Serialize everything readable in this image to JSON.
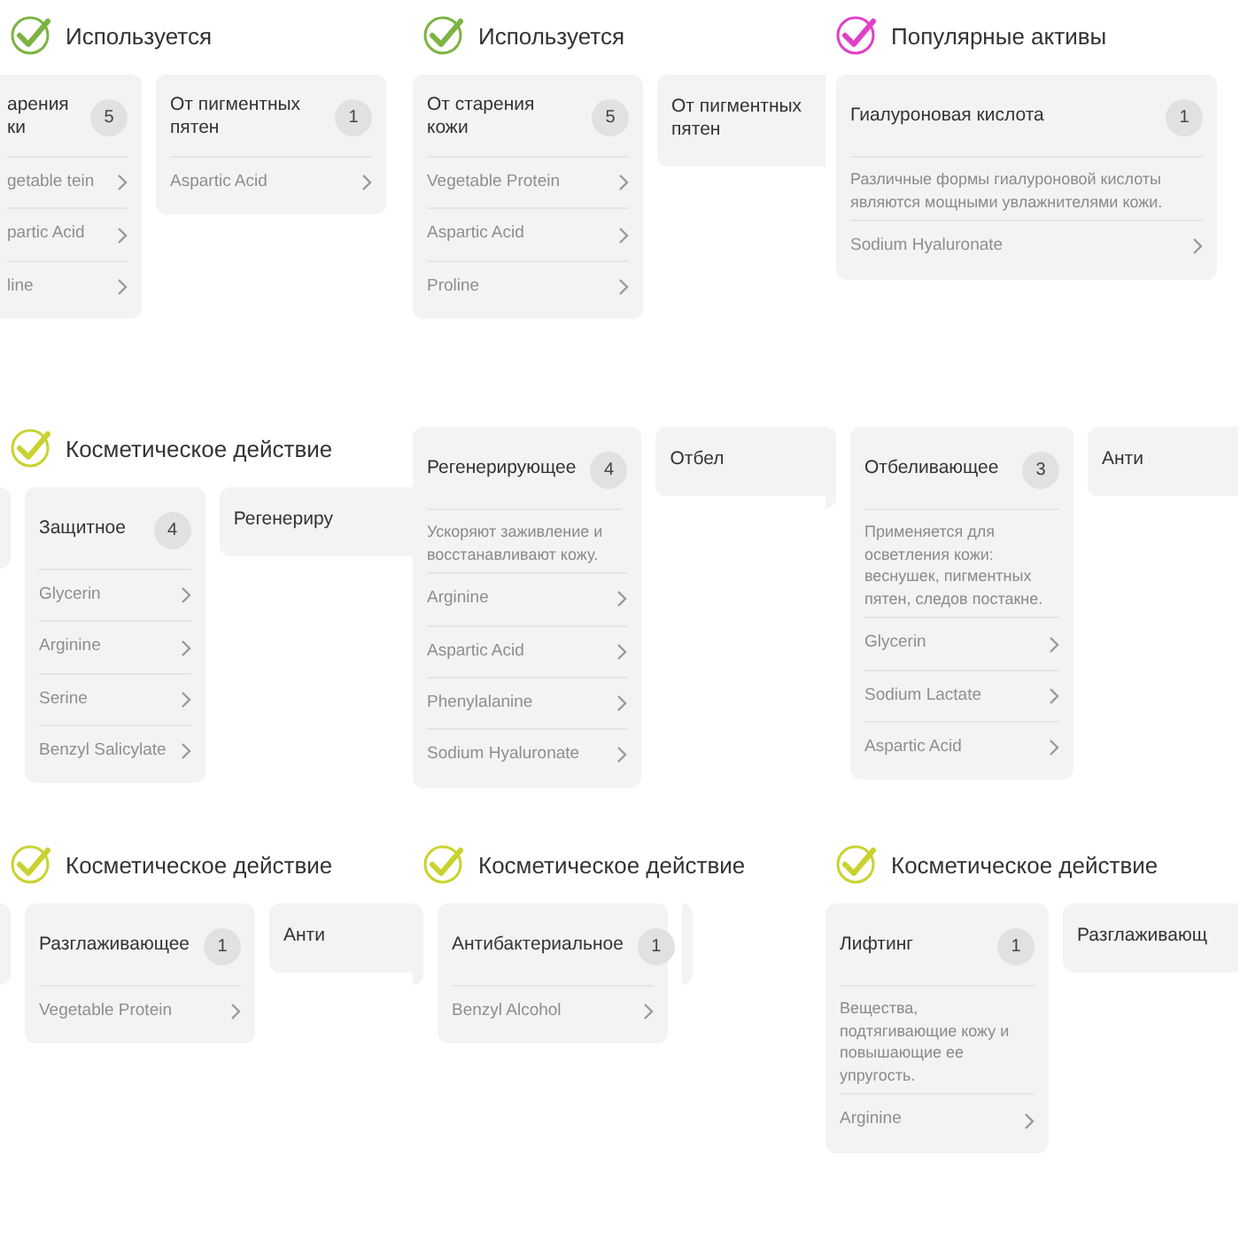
{
  "panels": [
    {
      "header": {
        "title": "Используется",
        "color": "#7cb342"
      },
      "cards": [
        {
          "kind": "cut-left",
          "title": "арения ки",
          "count": "5",
          "items": [
            "getable tein",
            "partic Acid",
            "line"
          ]
        },
        {
          "kind": "card",
          "title": "От пигментных пятен",
          "count": "1",
          "items": [
            "Aspartic Acid"
          ]
        }
      ]
    },
    {
      "header": {
        "title": "Используется",
        "color": "#7cb342"
      },
      "cards": [
        {
          "kind": "card",
          "title": "От старения кожи",
          "count": "5",
          "items": [
            "Vegetable Protein",
            "Aspartic Acid",
            "Proline"
          ]
        },
        {
          "kind": "cut-right",
          "title": "От пигментных пятен"
        }
      ]
    },
    {
      "header": {
        "title": "Популярные активы",
        "color": "#e040c8"
      },
      "cards": [
        {
          "kind": "card",
          "title": "Гиалуроновая кислота",
          "count": "1",
          "description": "Различные формы гиалуроновой кислоты являются мощными увлажнителями кожи.",
          "items": [
            "Sodium Hyaluronate"
          ]
        }
      ]
    },
    {
      "header": {
        "title": "Косметическое действие",
        "color": "#c9d22e"
      },
      "cards": [
        {
          "kind": "sliver"
        },
        {
          "kind": "card",
          "title": "Защитное",
          "count": "4",
          "items": [
            "Glycerin",
            "Arginine",
            "Serine",
            "Benzyl Salicylate"
          ]
        },
        {
          "kind": "cut-right",
          "title": "Регенериру"
        }
      ]
    },
    {
      "cards": [
        {
          "kind": "card",
          "title": "Регенерирующее",
          "count": "4",
          "description": "Ускоряют заживление и восстанавливают кожу.",
          "items": [
            "Arginine",
            "Aspartic Acid",
            "Phenylalanine",
            "Sodium Hyaluronate"
          ]
        },
        {
          "kind": "cut-right",
          "title": "Отбел"
        }
      ]
    },
    {
      "cards": [
        {
          "kind": "sliver"
        },
        {
          "kind": "card",
          "title": "Отбеливающее",
          "count": "3",
          "description": "Применяется для осветления кожи: веснушек, пигментных пятен, следов постакне.",
          "items": [
            "Glycerin",
            "Sodium Lactate",
            "Aspartic Acid"
          ]
        },
        {
          "kind": "cut-right",
          "title": "Анти"
        }
      ]
    },
    {
      "header": {
        "title": "Косметическое действие",
        "color": "#c9d22e"
      },
      "cards": [
        {
          "kind": "sliver"
        },
        {
          "kind": "card",
          "title": "Разглаживающее",
          "count": "1",
          "items": [
            "Vegetable Protein"
          ]
        },
        {
          "kind": "cut-right",
          "title": "Анти"
        }
      ]
    },
    {
      "header": {
        "title": "Косметическое действие",
        "color": "#c9d22e"
      },
      "cards": [
        {
          "kind": "sliver"
        },
        {
          "kind": "card",
          "title": "Антибактериальное",
          "count": "1",
          "items": [
            "Benzyl Alcohol"
          ]
        },
        {
          "kind": "sliver"
        }
      ]
    },
    {
      "header": {
        "title": "Косметическое действие",
        "color": "#c9d22e"
      },
      "cards": [
        {
          "kind": "card",
          "title": "Лифтинг",
          "count": "1",
          "description": "Вещества, подтягивающие кожу и повышающие ее упругость.",
          "items": [
            "Arginine"
          ]
        },
        {
          "kind": "cut-right",
          "title": "Разглаживающ"
        }
      ]
    }
  ]
}
